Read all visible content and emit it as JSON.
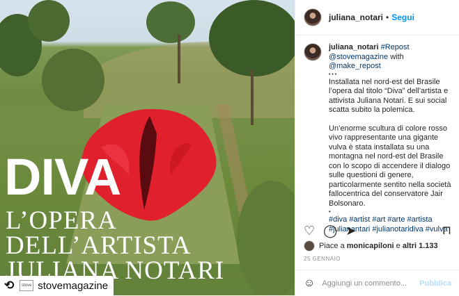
{
  "photo": {
    "overlay_title": "DIVA",
    "overlay_caption_lines": [
      "L’OPERA",
      "DELL’ARTISTA",
      "JULIANA NOTARI"
    ],
    "repost_label": "stovemagazine",
    "repost_logo_text": "stove"
  },
  "header": {
    "username": "juliana_notari",
    "separator": "•",
    "follow_label": "Segui"
  },
  "post": {
    "username": "juliana_notari",
    "repost_tag": "#Repost",
    "source_user": "@stovemagazine",
    "with_text": "with",
    "app_user": "@make_repost",
    "bullets": "• • •",
    "paragraph1": "Installata nel nord-est del Brasile l’opera dal titolo “Diva” dell’artista e attivista Juliana Notari. E sui social scatta subito la polemica.",
    "paragraph2": "Un’enorme scultura di colore rosso vivo rappresentante una gigante vulva è stata installata su una montagna nel nord-est del Brasile con lo scopo di accendere il dialogo sulle questioni di genere, particolarmente sentito nella società fallocentrica del conservatore Jair Bolsonaro.",
    "bullet_single": "•",
    "hashtags": "#diva #artist #art #arte #artista #julianantari #julianotaridiva #vulva"
  },
  "actions": {
    "like_icon": "heart-icon",
    "comment_icon": "comment-icon",
    "share_icon": "share-icon",
    "save_icon": "bookmark-icon"
  },
  "likes": {
    "prefix": "Piace a",
    "user": "monicapiloni",
    "connector": "e",
    "others": "altri 1.133"
  },
  "date": "25 GENNAIO",
  "comment": {
    "placeholder": "Aggiungi un commento...",
    "publish_label": "Pubblica"
  },
  "colors": {
    "accent": "#0095f6",
    "sculpture": "#e0202c",
    "publish_disabled": "#b2dffc"
  }
}
